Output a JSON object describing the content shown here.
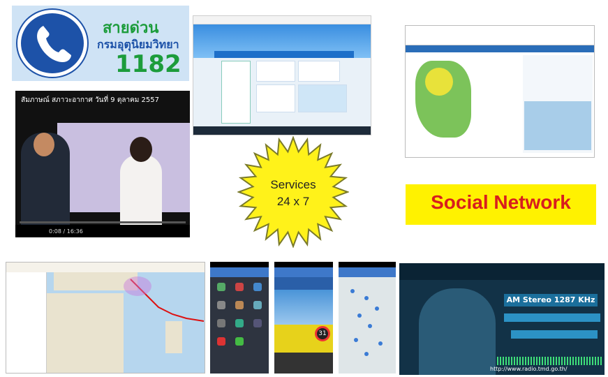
{
  "hotline": {
    "line1": "สายด่วน",
    "line2": "กรมอุตุนิยมวิทยา",
    "number": "1182"
  },
  "video": {
    "title": "สัมภาษณ์ สภาวะอากาศ วันที่ 9 ตุลาคม 2557",
    "time": "0:08 / 16:36"
  },
  "services": {
    "line1": "Services",
    "line2": "24 x 7"
  },
  "social": {
    "label": "Social Network"
  },
  "radio": {
    "am_label": "AM Stereo 1287 KHz",
    "url": "http://www.radio.tmd.go.th/"
  },
  "colors": {
    "burst_fill": "#fff21a",
    "burst_stroke": "#7a7a2a",
    "social_bg": "#fff200",
    "social_text": "#d81e1e",
    "hotline_green": "#1c9c3b",
    "hotline_blue": "#1d52a8"
  }
}
